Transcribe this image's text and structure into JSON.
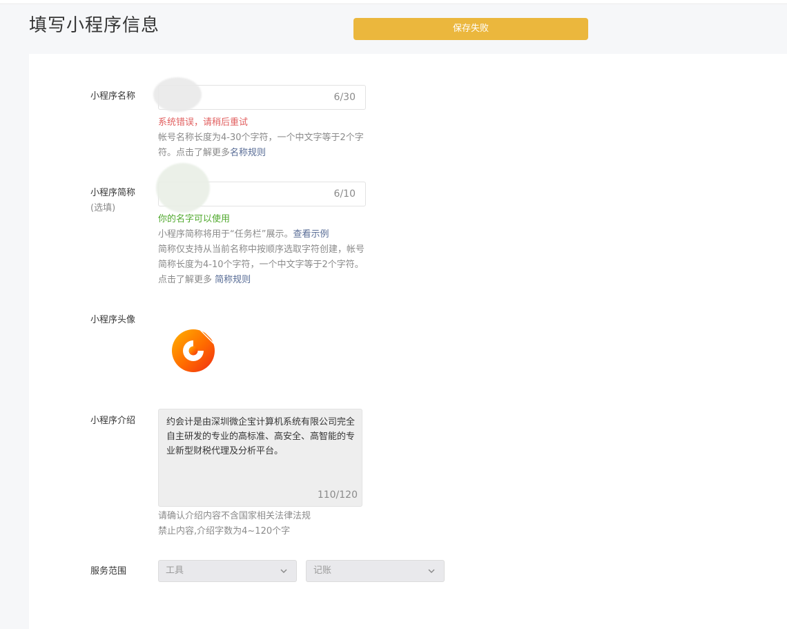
{
  "page": {
    "title": "填写小程序信息",
    "toast": "保存失败"
  },
  "colors": {
    "toast_bg": "#ebb73d",
    "error": "#e15f5f",
    "success": "#4fa82c",
    "link": "#576b95"
  },
  "name_field": {
    "label": "小程序名称",
    "count": "6/30",
    "error": "系统错误，请稍后重试",
    "help_1": "帐号名称长度为4-30个字符，一个中文字等于2个字符。点击了解更多",
    "help_link": "名称规则"
  },
  "short_name_field": {
    "label": "小程序简称",
    "sublabel": "(选填)",
    "count": "6/10",
    "success": "你的名字可以使用",
    "help_1": "小程序简称将用于“任务栏”展示。",
    "help_link_1": "查看示例",
    "help_2": "简称仅支持从当前名称中按顺序选取字符创建，帐号简称长度为4-10个字符，一个中文字等于2个字符。点击了解更多 ",
    "help_link_2": "简称规则"
  },
  "avatar_field": {
    "label": "小程序头像",
    "icon": "swirl-logo-icon"
  },
  "intro_field": {
    "label": "小程序介绍",
    "value": "约会计是由深圳微企宝计算机系统有限公司完全自主研发的专业的高标准、高安全、高智能的专业新型财税代理及分析平台。",
    "count": "110/120",
    "help_1": "请确认介绍内容不含国家相关法律法规",
    "help_2": "禁止内容,介绍字数为4~120个字"
  },
  "service_field": {
    "label": "服务范围",
    "select_1": "工具",
    "select_2": "记账",
    "icon": "chevron-down-icon"
  }
}
